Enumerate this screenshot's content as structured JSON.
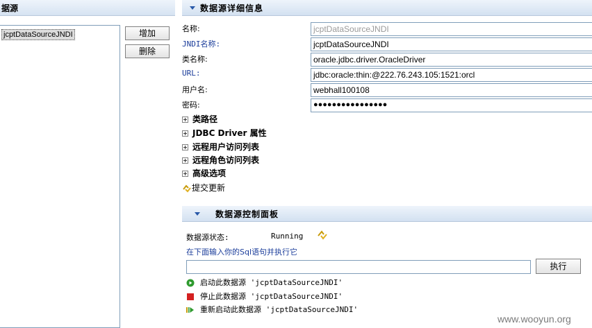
{
  "left_panel": {
    "title": "据源",
    "list_items": [
      "jcptDataSourceJNDI"
    ],
    "add_button": "增加",
    "delete_button": "删除"
  },
  "detail": {
    "title": "数据源详细信息",
    "fields": {
      "name_label": "名称:",
      "name_value": "jcptDataSourceJNDI",
      "jndi_label": "JNDI名称:",
      "jndi_value": "jcptDataSourceJNDI",
      "class_label": "类名称:",
      "class_value": "oracle.jdbc.driver.OracleDriver",
      "url_label": "URL:",
      "url_value": "jdbc:oracle:thin:@222.76.243.105:1521:orcl",
      "user_label": "用户名:",
      "user_value": "webhall100108",
      "password_label": "密码:",
      "password_value": "●●●●●●●●●●●●●●●●"
    },
    "expanders": [
      "类路径",
      "JDBC Driver 属性",
      "远程用户访问列表",
      "远程角色访问列表",
      "高级选项"
    ],
    "submit_label": "提交更新"
  },
  "control": {
    "title": "数据源控制面板",
    "status_label": "数据源状态:",
    "status_value": "Running",
    "sql_hint": "在下面输入你的Sql语句并执行它",
    "sql_input_value": "",
    "execute_button": "执行",
    "actions": [
      "启动此数据源 'jcptDataSourceJNDI'",
      "停止此数据源 'jcptDataSourceJNDI'",
      "重新启动此数据源 'jcptDataSourceJNDI'"
    ]
  },
  "watermark": "www.wooyun.org",
  "colors": {
    "header_bg": "#d6e3f2",
    "label_blue": "#1a3c9a",
    "start_green": "#2e9a2e",
    "stop_red": "#d42020"
  }
}
